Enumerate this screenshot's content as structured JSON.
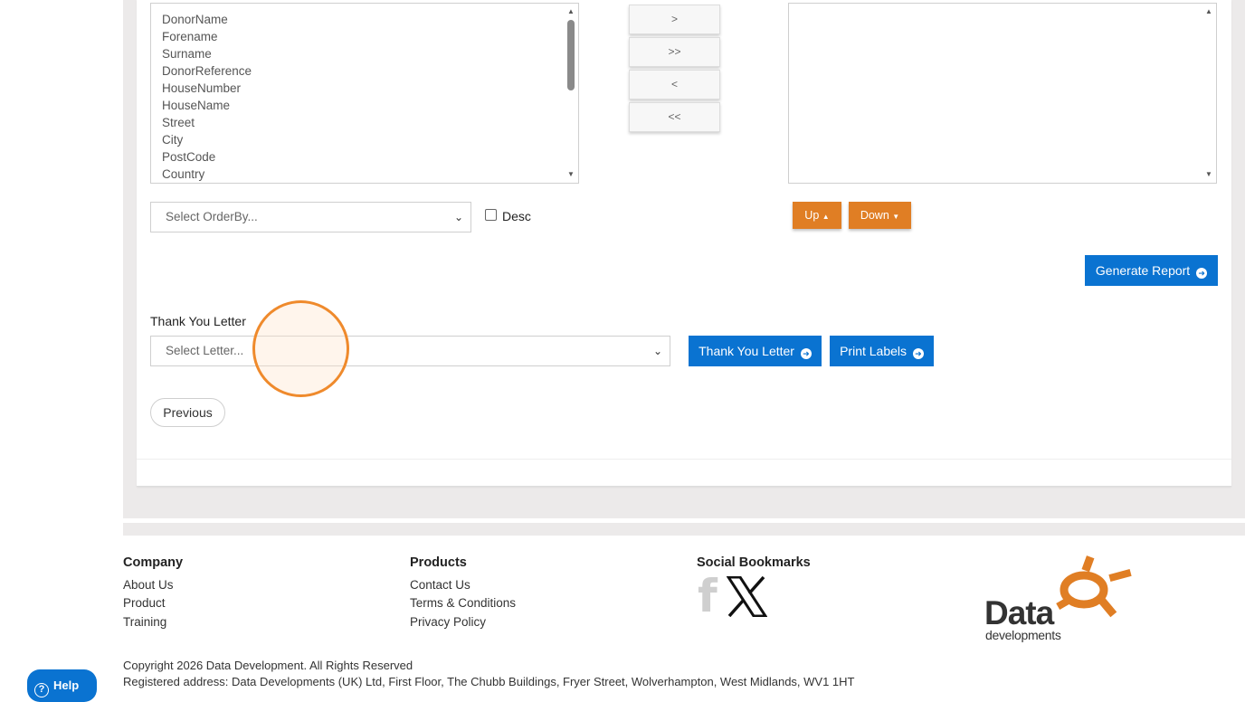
{
  "available_fields": [
    "DonorName",
    "Forename",
    "Surname",
    "DonorReference",
    "HouseNumber",
    "HouseName",
    "Street",
    "City",
    "PostCode",
    "Country"
  ],
  "move_buttons": {
    "move_right": ">",
    "move_all_right": ">>",
    "move_left": "<",
    "move_all_left": "<<"
  },
  "order_by": {
    "placeholder": "Select OrderBy...",
    "desc_label": "Desc"
  },
  "reorder": {
    "up_label": "Up",
    "down_label": "Down"
  },
  "generate_report_label": "Generate Report",
  "thank_you": {
    "label": "Thank You Letter",
    "select_placeholder": "Select Letter...",
    "letter_button": "Thank You Letter",
    "labels_button": "Print Labels"
  },
  "previous_label": "Previous",
  "footer": {
    "company": {
      "heading": "Company",
      "links": [
        "About Us",
        "Product",
        "Training"
      ]
    },
    "products": {
      "heading": "Products",
      "links": [
        "Contact Us",
        "Terms & Conditions",
        "Privacy Policy"
      ]
    },
    "social": {
      "heading": "Social Bookmarks",
      "facebook": "f"
    },
    "logo": {
      "main": "Data",
      "sub": "developments"
    },
    "copyright": "Copyright 2026 Data Development. All Rights Reserved",
    "address": "Registered address: Data Developments (UK) Ltd, First Floor, The Chubb Buildings, Fryer Street, Wolverhampton, West Midlands, WV1 1HT"
  },
  "help_label": "Help",
  "colors": {
    "accent_blue": "#0a73d1",
    "accent_orange": "#e07e24"
  }
}
